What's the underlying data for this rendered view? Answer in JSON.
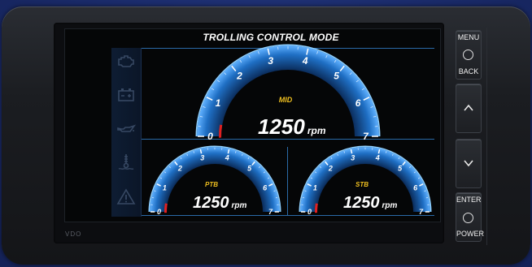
{
  "display": {
    "title": "TROLLING CONTROL MODE",
    "brand": "VDO"
  },
  "colors": {
    "accent_blue": "#1f6fc4",
    "label_yellow": "#f0c020",
    "redline": "#e02020"
  },
  "side_icons": [
    "engine-icon",
    "battery-icon",
    "oil-can-icon",
    "coolant-temp-icon",
    "warning-icon"
  ],
  "gauges": {
    "main": {
      "label": "MID",
      "value": "1250",
      "unit": "rpm",
      "ticks": [
        "0",
        "1",
        "2",
        "3",
        "4",
        "5",
        "6",
        "7"
      ],
      "fill_fraction": 0.18
    },
    "left": {
      "label": "PTB",
      "value": "1250",
      "unit": "rpm",
      "ticks": [
        "0",
        "1",
        "2",
        "3",
        "4",
        "5",
        "6",
        "7"
      ],
      "fill_fraction": 0.18
    },
    "right": {
      "label": "STB",
      "value": "1250",
      "unit": "rpm",
      "ticks": [
        "0",
        "1",
        "2",
        "3",
        "4",
        "5",
        "6",
        "7"
      ],
      "fill_fraction": 0.18
    }
  },
  "buttons": {
    "menu": {
      "top_label": "MENU",
      "bottom_label": "BACK"
    },
    "enter": {
      "top_label": "ENTER",
      "bottom_label": "POWER"
    }
  }
}
